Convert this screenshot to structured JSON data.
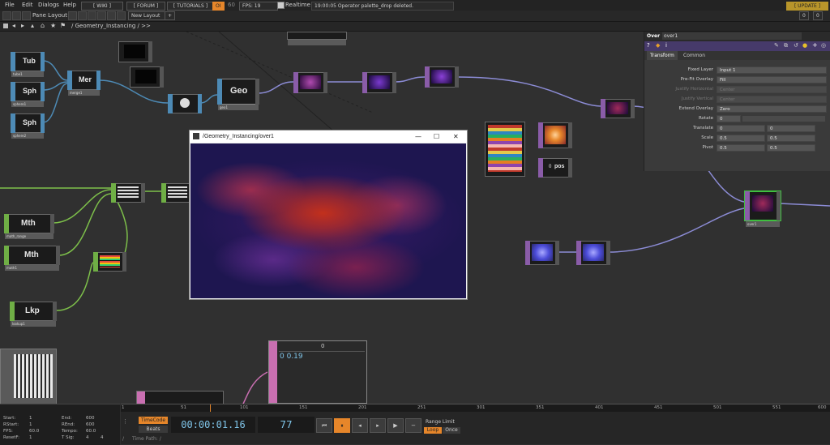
{
  "menu": {
    "items": [
      "File",
      "Edit",
      "Dialogs",
      "Help"
    ],
    "wiki": "[ WIKI ]",
    "forum": "[ FORUM ]",
    "tutorials": "[ TUTORIALS ]",
    "oi": "OI",
    "sixty": "60",
    "fps": "FPS: 19",
    "realtime": "Realtime",
    "status_msg": "19:00:05 Operator palette_drop deleted.",
    "update": "[ UPDATE ]"
  },
  "panebar": {
    "pane_layout": "Pane Layout",
    "new_layout": "New Layout",
    "add": "+",
    "right_0": "0",
    "right_1": "0"
  },
  "pathbar": {
    "path": "/ Geometry_Instancing / >>"
  },
  "nodes": {
    "tub": "Tub",
    "sph1": "Sph",
    "sph2": "Sph",
    "mer": "Mer",
    "geo": "Geo",
    "mth1": "Mth",
    "mth2": "Mth",
    "lkp": "Lkp",
    "pos": "pos",
    "num_zero": "0",
    "num_val": "0 0.19",
    "chop_label": "0",
    "labels": {
      "tub": "tube1",
      "sph1": "sphere1",
      "sph2": "sphere2",
      "mer": "merge1",
      "geo": "geo1",
      "mth1": "math_range",
      "mth2": "math1",
      "lkp": "lookup1",
      "over1": "over1"
    }
  },
  "viewer": {
    "title": "/Geometry_Instancing/over1",
    "min": "—",
    "max": "☐",
    "close": "✕"
  },
  "params": {
    "op_type": "Over",
    "op_name": "over1",
    "tabs": [
      "Transform",
      "Common"
    ],
    "rows": [
      {
        "label": "Fixed Layer",
        "value": "Input 1",
        "dropdown": true,
        "disabled": false
      },
      {
        "label": "Pre-Fit Overlay",
        "value": "Fill",
        "dropdown": true,
        "disabled": false
      },
      {
        "label": "Justify Horizontal",
        "value": "Center",
        "dropdown": true,
        "disabled": true
      },
      {
        "label": "Justify Vertical",
        "value": "Center",
        "dropdown": true,
        "disabled": true
      },
      {
        "label": "Extend Overlay",
        "value": "Zero",
        "dropdown": true,
        "disabled": false
      },
      {
        "label": "Rotate",
        "value": "0",
        "dropdown": false,
        "disabled": false
      },
      {
        "label": "Translate",
        "value": "0",
        "value2": "0",
        "dropdown": false,
        "disabled": false
      },
      {
        "label": "Scale",
        "value": "0.5",
        "value2": "0.5",
        "dropdown": false,
        "disabled": false
      },
      {
        "label": "Pivot",
        "value": "0.5",
        "value2": "0.5",
        "dropdown": false,
        "disabled": false
      }
    ]
  },
  "ruler": {
    "ticks": [
      "1",
      "51",
      "101",
      "151",
      "201",
      "251",
      "301",
      "351",
      "401",
      "451",
      "501",
      "551",
      "600"
    ]
  },
  "info": {
    "start_label": "Start:",
    "start": "1",
    "end_label": "End:",
    "end": "600",
    "rstart_label": "RStart:",
    "rstart": "1",
    "rend_label": "REnd:",
    "rend": "600",
    "fps_label": "FPS:",
    "fps": "60.0",
    "tempo_label": "Tempo:",
    "tempo": "60.0",
    "resetf_label": "ResetF:",
    "resetf": "1",
    "tsig_label": "T Sig:",
    "tsig1": "4",
    "tsig2": "4"
  },
  "transport": {
    "timecode_btn": "TimeCode",
    "beats_btn": "Beats",
    "timecode": "00:00:01.16",
    "frame": "77",
    "range_limit": "Range Limit",
    "loop": "Loop",
    "once": "Once",
    "time_path": "Time Path: /"
  },
  "colors": {
    "accent_orange": "#e6862a",
    "top_wire": "#8c8cd6",
    "sop_wire": "#4d8ab5",
    "chop_wire": "#7dbf4a",
    "dat_wire": "#c96fb1"
  }
}
